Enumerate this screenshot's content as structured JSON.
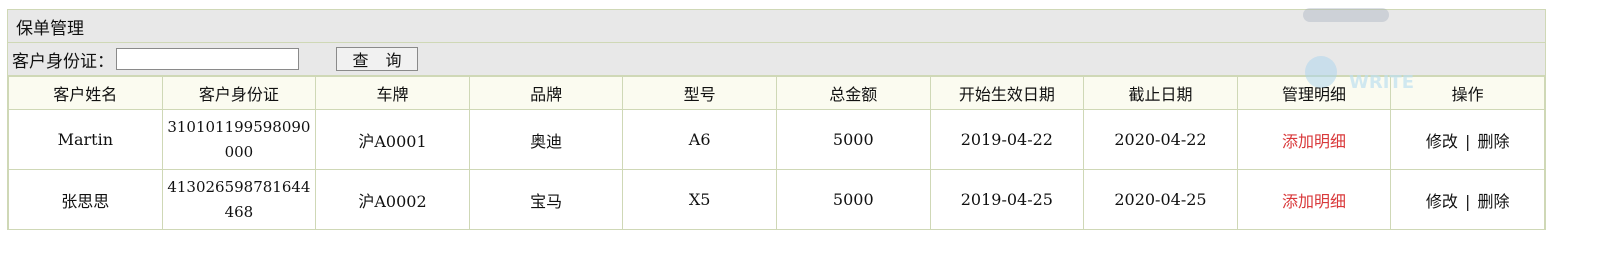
{
  "panel": {
    "title": "保单管理"
  },
  "search": {
    "label": "客户身份证：",
    "value": "",
    "button": "查 询"
  },
  "table": {
    "columns": [
      "客户姓名",
      "客户身份证",
      "车牌",
      "品牌",
      "型号",
      "总金额",
      "开始生效日期",
      "截止日期",
      "管理明细",
      "操作"
    ],
    "rows": [
      {
        "name": "Martin",
        "id_card": "310101199598090000",
        "plate": "沪A0001",
        "brand": "奥迪",
        "model": "A6",
        "total": "5000",
        "start": "2019-04-22",
        "end": "2020-04-22",
        "detail": "添加明细",
        "edit": "修改",
        "sep": "|",
        "delete": "删除"
      },
      {
        "name": "张思思",
        "id_card": "413026598781644468",
        "plate": "沪A0002",
        "brand": "宝马",
        "model": "X5",
        "total": "5000",
        "start": "2019-04-25",
        "end": "2020-04-25",
        "detail": "添加明细",
        "edit": "修改",
        "sep": "|",
        "delete": "删除"
      }
    ]
  },
  "colors": {
    "border": "#cfd8b6",
    "link": "#d9393b",
    "header_bg": "#e8e8e8"
  },
  "watermark": {
    "text": "WRITE"
  }
}
